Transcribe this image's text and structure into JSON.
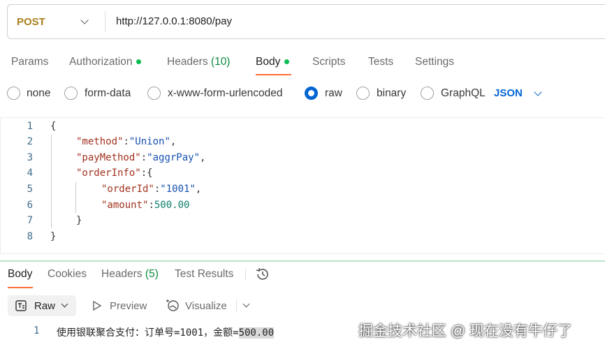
{
  "request": {
    "method": "POST",
    "url": "http://127.0.0.1:8080/pay"
  },
  "request_tabs": [
    {
      "label": "Params"
    },
    {
      "label": "Authorization",
      "dot": true
    },
    {
      "label": "Headers",
      "count": "(10)"
    },
    {
      "label": "Body",
      "dot": true,
      "active": true
    },
    {
      "label": "Scripts"
    },
    {
      "label": "Tests"
    },
    {
      "label": "Settings"
    }
  ],
  "body_types": [
    "none",
    "form-data",
    "x-www-form-urlencoded",
    "raw",
    "binary",
    "GraphQL"
  ],
  "selected_body_type": "raw",
  "format": "JSON",
  "code_lines": [
    "1",
    "2",
    "3",
    "4",
    "5",
    "6",
    "7",
    "8"
  ],
  "code": {
    "k_method": "\"method\"",
    "v_method": "\"Union\"",
    "k_pay": "\"payMethod\"",
    "v_pay": "\"aggrPay\"",
    "k_order": "\"orderInfo\"",
    "k_id": "\"orderId\"",
    "v_id": "\"1001\"",
    "k_amount": "\"amount\"",
    "v_amount": "500.00"
  },
  "response_tabs": [
    {
      "label": "Body",
      "active": true
    },
    {
      "label": "Cookies"
    },
    {
      "label": "Headers",
      "count": "(5)"
    },
    {
      "label": "Test Results"
    }
  ],
  "response_toolbar": {
    "raw": "Raw",
    "preview": "Preview",
    "visualize": "Visualize"
  },
  "response": {
    "line": "1",
    "text": "使用银联聚合支付：订单号=1001，金额=",
    "highlight": "500.00"
  },
  "watermark": "掘金技术社区 @ 现在没有牛仔了"
}
